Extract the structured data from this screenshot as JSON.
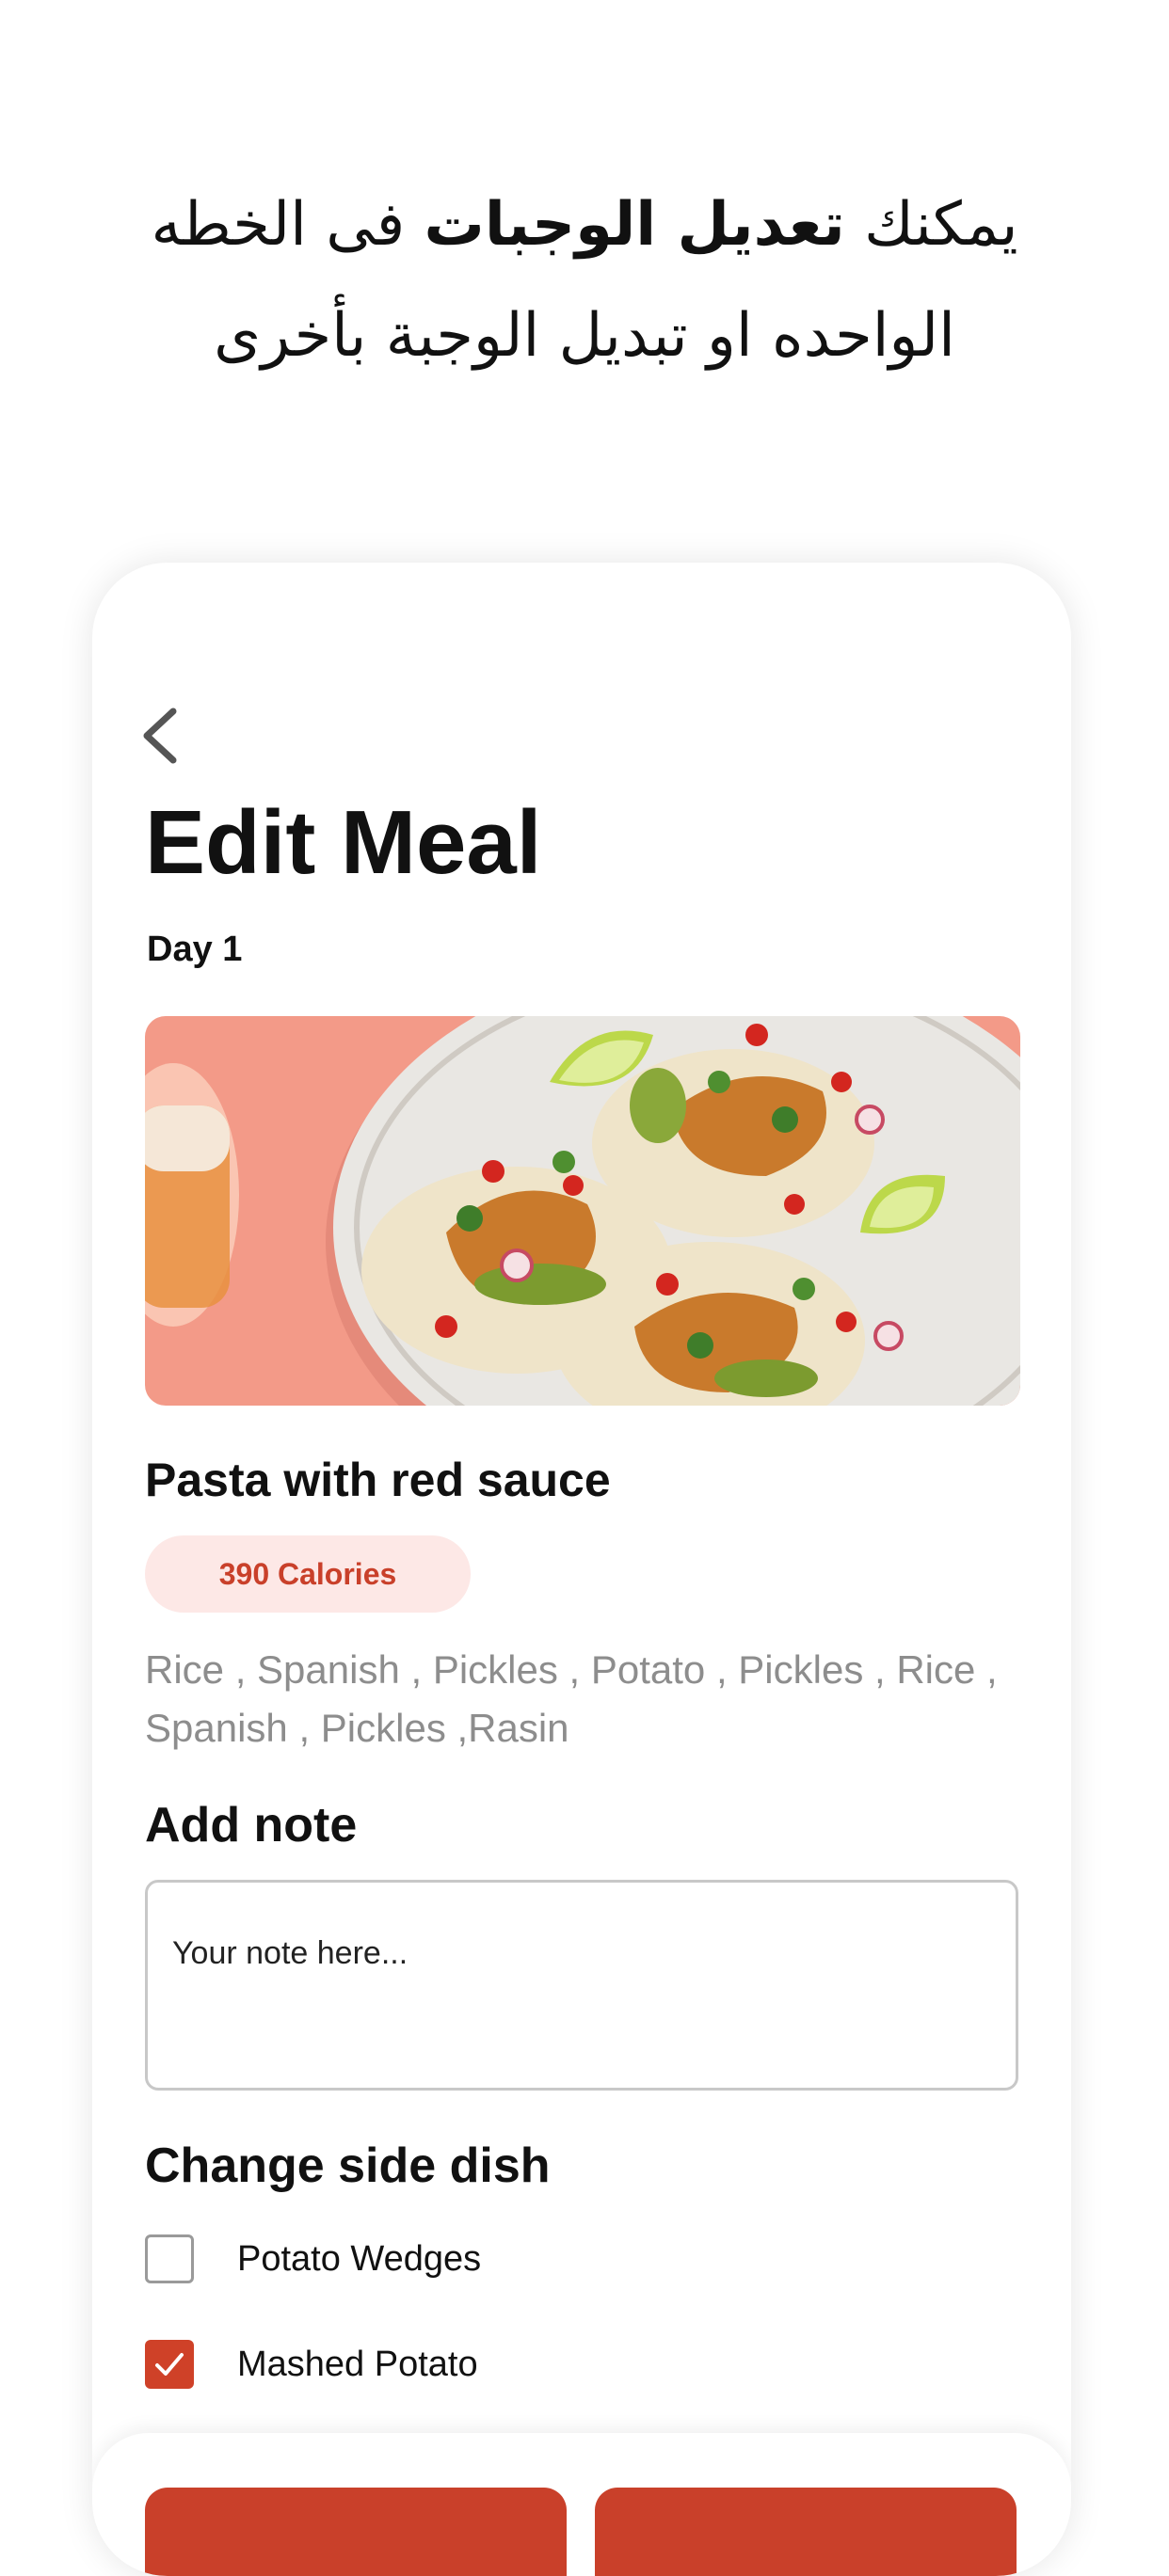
{
  "promo": {
    "line1_prefix": "يمكنك",
    "line1_bold": "تعديل الوجبات",
    "line1_suffix": "فى الخطه",
    "line2": "الواحده او تبديل الوجبة بأخرى"
  },
  "screen": {
    "title": "Edit Meal",
    "day": "Day 1",
    "back_icon": "chevron-left-icon"
  },
  "meal": {
    "name": "Pasta with red sauce",
    "calories": "390 Calories",
    "ingredients": "Rice , Spanish , Pickles , Potato , Pickles , Rice , Spanish , Pickles ,Rasin"
  },
  "note": {
    "title": "Add note",
    "placeholder": "Your note here..."
  },
  "side_dish": {
    "title": "Change side dish",
    "options": [
      {
        "label": "Potato Wedges",
        "checked": false
      },
      {
        "label": "Mashed Potato",
        "checked": true
      }
    ]
  },
  "colors": {
    "accent": "#c9402a",
    "badge_bg": "#fde8e6",
    "muted_text": "#8d8d8d"
  }
}
